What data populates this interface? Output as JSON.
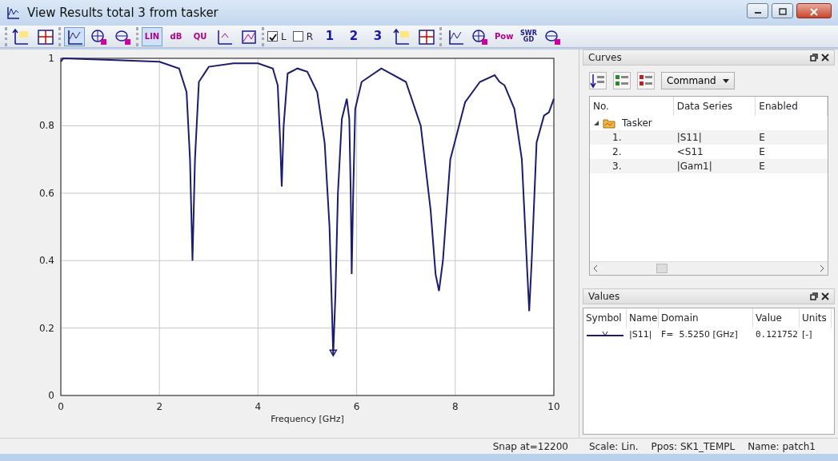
{
  "window": {
    "title": "View Results total 3 from tasker"
  },
  "toolbar": [
    [
      {
        "kind": "icon",
        "selected": false
      },
      {
        "kind": "icon",
        "selected": false
      }
    ],
    [
      {
        "kind": "icon",
        "selected": true
      },
      {
        "kind": "icon",
        "selected": false
      },
      {
        "kind": "icon",
        "selected": false
      }
    ],
    [
      {
        "kind": "text",
        "label": "LIN",
        "selected": true
      },
      {
        "kind": "text",
        "label": "dB",
        "selected": false
      },
      {
        "kind": "text",
        "label": "QU",
        "selected": false
      },
      {
        "kind": "icon",
        "selected": false
      },
      {
        "kind": "icon",
        "selected": false
      }
    ],
    [
      {
        "kind": "check",
        "label": "L",
        "checked": true
      },
      {
        "kind": "check",
        "label": "R",
        "checked": false
      },
      {
        "kind": "text",
        "label": "1",
        "selected": false
      },
      {
        "kind": "text",
        "label": "2",
        "selected": false
      },
      {
        "kind": "text",
        "label": "3",
        "selected": false
      },
      {
        "kind": "icon",
        "selected": false
      },
      {
        "kind": "icon",
        "selected": false
      }
    ],
    [
      {
        "kind": "icon",
        "selected": false
      },
      {
        "kind": "icon",
        "selected": false
      },
      {
        "kind": "text",
        "label": "Pow",
        "selected": false
      },
      {
        "kind": "text",
        "label": "SWR GD",
        "selected": false
      },
      {
        "kind": "icon",
        "selected": false
      }
    ]
  ],
  "chart": {
    "chart_data": {
      "type": "line",
      "xlabel": "Frequency [GHz]",
      "xlim": [
        0,
        10
      ],
      "ylim": [
        0,
        1
      ],
      "xticks": [
        0,
        2,
        4,
        6,
        8,
        10
      ],
      "yticks": [
        0,
        {
          "value": 0.2,
          "label": "0.2"
        },
        {
          "value": 0.4,
          "label": "0.4"
        },
        {
          "value": 0.6,
          "label": "0.6"
        },
        {
          "value": 0.8,
          "label": "0.8"
        },
        1
      ],
      "x": [
        0,
        0.05,
        1,
        2,
        2.4,
        2.55,
        2.62,
        2.67,
        2.72,
        2.8,
        3,
        3.5,
        4,
        4.3,
        4.4,
        4.45,
        4.48,
        4.52,
        4.6,
        4.8,
        5,
        5.2,
        5.35,
        5.45,
        5.5,
        5.525,
        5.57,
        5.62,
        5.7,
        5.8,
        5.85,
        5.88,
        5.9,
        5.93,
        5.97,
        6.1,
        6.5,
        7,
        7.3,
        7.5,
        7.6,
        7.67,
        7.75,
        7.9,
        8.2,
        8.5,
        8.8,
        8.9,
        9,
        9.2,
        9.35,
        9.45,
        9.5,
        9.55,
        9.65,
        9.8,
        9.9,
        10
      ],
      "series": [
        {
          "color": "#1c1c6e",
          "values": [
            0.99,
            1,
            0.995,
            0.99,
            0.97,
            0.9,
            0.7,
            0.4,
            0.7,
            0.93,
            0.975,
            0.985,
            0.985,
            0.97,
            0.92,
            0.75,
            0.62,
            0.8,
            0.955,
            0.97,
            0.96,
            0.9,
            0.75,
            0.5,
            0.25,
            0.12,
            0.3,
            0.6,
            0.82,
            0.88,
            0.82,
            0.6,
            0.36,
            0.6,
            0.85,
            0.93,
            0.97,
            0.93,
            0.8,
            0.55,
            0.36,
            0.31,
            0.4,
            0.7,
            0.87,
            0.93,
            0.95,
            0.93,
            0.92,
            0.85,
            0.7,
            0.4,
            0.25,
            0.4,
            0.75,
            0.83,
            0.84,
            0.88
          ]
        }
      ],
      "grid": true
    }
  },
  "curves": {
    "title": "Curves",
    "command": "Command",
    "columns": [
      "No.",
      "Data Series",
      "Enabled"
    ],
    "tree": [
      {
        "label": "Tasker",
        "expanded": true,
        "children": [
          {
            "no": "1.",
            "series": "|S11|",
            "enabled": "E"
          },
          {
            "no": "2.",
            "series": "<S11",
            "enabled": "E"
          },
          {
            "no": "3.",
            "series": "|Gam1|",
            "enabled": "E"
          }
        ]
      }
    ]
  },
  "values": {
    "title": "Values",
    "columns": [
      "Symbol",
      "Name",
      "Domain",
      "Value",
      "Units"
    ],
    "rows": [
      {
        "color": "#1c1c6e",
        "name": "|S11|",
        "domain": "F=  5.5250 [GHz]",
        "value": "0.121752",
        "units": "[-]"
      }
    ]
  },
  "status_bar": [
    "Snap at=12200",
    "Scale: Lin.",
    "Ppos: SK1_TEMPL",
    "Name: patch1"
  ]
}
